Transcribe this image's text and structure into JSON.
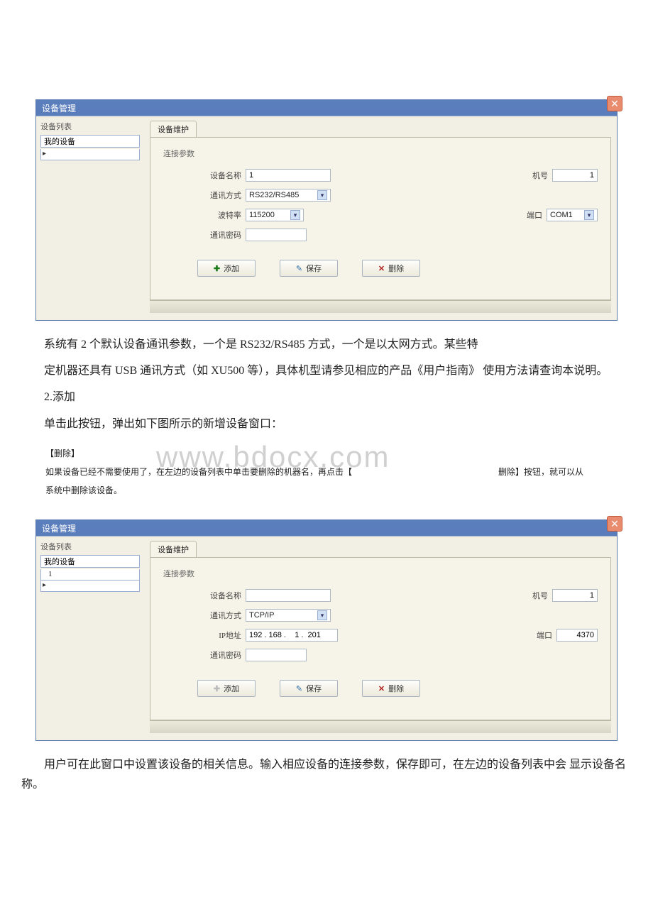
{
  "watermark": "www.bdocx.com",
  "win1": {
    "title": "设备管理",
    "close": "✕",
    "left_label": "设备列表",
    "left_value": "我的设备",
    "tab": "设备维护",
    "fieldset": "连接参数",
    "name_label": "设备名称",
    "name_value": "1",
    "no_label": "机号",
    "no_value": "1",
    "comm_label": "通讯方式",
    "comm_value": "RS232/RS485",
    "baud_label": "波特率",
    "baud_value": "115200",
    "port_label": "端口",
    "port_value": "COM1",
    "pwd_label": "通讯密码",
    "pwd_value": "",
    "btn_add": "添加",
    "btn_save": "保存",
    "btn_del": "删除"
  },
  "para1": "系统有 2 个默认设备通讯参数，一个是 RS232/RS485 方式，一个是以太网方式。某些特",
  "para2": "定机器还具有 USB 通讯方式（如 XU500 等），具体机型请参见相应的产品《用户指南》 使用方法请查询本说明。",
  "para3": "2.添加",
  "para4": "单击此按钮，弹出如下图所示的新增设备窗口：",
  "small_section": "【删除】",
  "small_body1": "如果设备已经不需要使用了，在左边的设备列表中单击要删除的机器名，再点击【",
  "small_body1_r": "删除】按钮，就可以从",
  "small_body2": "系统中删除该设备。",
  "win2": {
    "title": "设备管理",
    "close": "✕",
    "left_label": "设备列表",
    "left_value": "我的设备",
    "left_row": "1",
    "tab": "设备维护",
    "fieldset": "连接参数",
    "name_label": "设备名称",
    "name_value": "",
    "no_label": "机号",
    "no_value": "1",
    "comm_label": "通讯方式",
    "comm_value": "TCP/IP",
    "ip_label": "IP地址",
    "ip_value": "192 . 168 .    1 .  201",
    "port_label": "端口",
    "port_value": "4370",
    "pwd_label": "通讯密码",
    "pwd_value": "",
    "btn_add": "添加",
    "btn_save": "保存",
    "btn_del": "删除"
  },
  "para5": "用户可在此窗口中设置该设备的相关信息。输入相应设备的连接参数，保存即可，在左边的设备列表中会 显示设备名称。"
}
